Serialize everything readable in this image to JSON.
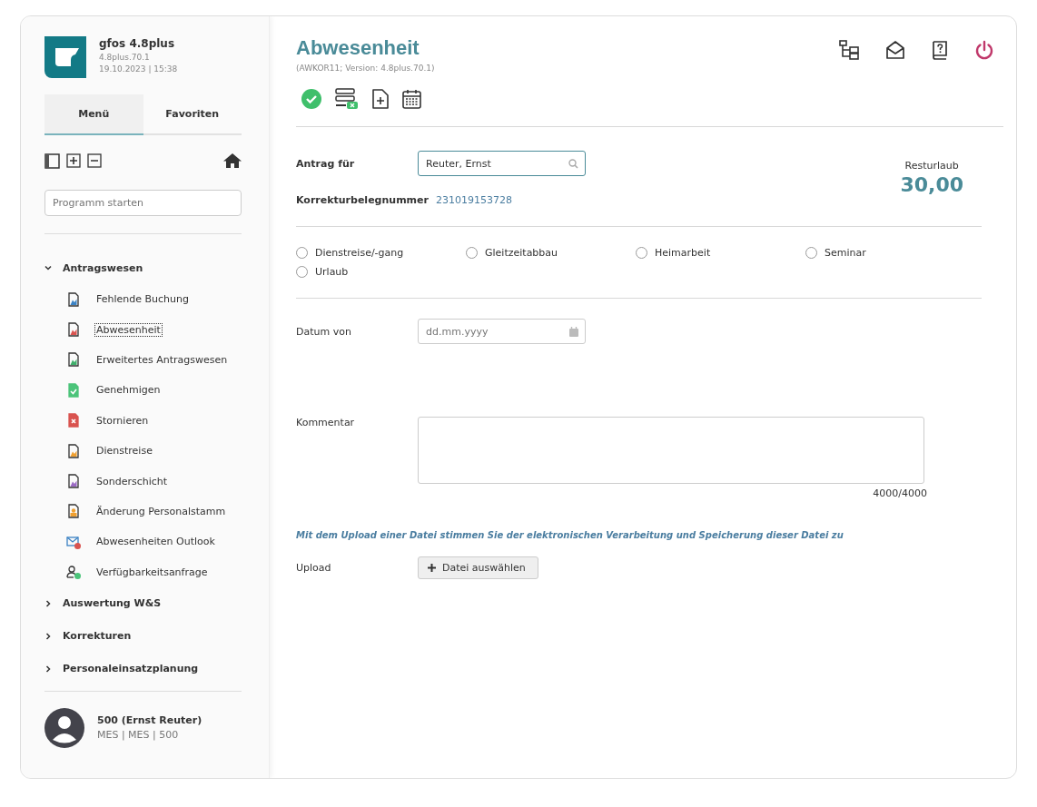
{
  "app": {
    "name": "gfos 4.8plus",
    "version": "4.8plus.70.1",
    "datetime": "19.10.2023 | 15:38"
  },
  "tabs": [
    {
      "label": "Menü",
      "selected": true
    },
    {
      "label": "Favoriten",
      "selected": false
    }
  ],
  "program_search": {
    "placeholder": "Programm starten"
  },
  "menu": [
    {
      "label": "Antragswesen",
      "expanded": true,
      "children": [
        {
          "label": "Fehlende Buchung",
          "kind": "doc",
          "color": "#3b82c4",
          "selected": false
        },
        {
          "label": "Abwesenheit",
          "kind": "doc",
          "color": "#d9534f",
          "selected": true
        },
        {
          "label": "Erweitertes Antragswesen",
          "kind": "doc",
          "color": "#3fae6a",
          "selected": false
        },
        {
          "label": "Genehmigen",
          "kind": "check",
          "color": "#4cc47a",
          "selected": false
        },
        {
          "label": "Stornieren",
          "kind": "cross",
          "color": "#d9534f",
          "selected": false
        },
        {
          "label": "Dienstreise",
          "kind": "doc",
          "color": "#f0a030",
          "selected": false
        },
        {
          "label": "Sonderschicht",
          "kind": "doc",
          "color": "#9b6ac4",
          "selected": false
        },
        {
          "label": "Änderung Personalstamm",
          "kind": "person-doc",
          "color": "#f0a030",
          "selected": false
        },
        {
          "label": "Abwesenheiten Outlook",
          "kind": "mail",
          "color": "#d9534f",
          "selected": false
        },
        {
          "label": "Verfügbarkeitsanfrage",
          "kind": "user",
          "color": "#4cc47a",
          "selected": false
        }
      ]
    },
    {
      "label": "Auswertung W&S",
      "expanded": false
    },
    {
      "label": "Korrekturen",
      "expanded": false
    },
    {
      "label": "Personaleinsatzplanung",
      "expanded": false
    }
  ],
  "user": {
    "name": "500 (Ernst Reuter)",
    "detail": "MES | MES | 500"
  },
  "page": {
    "title": "Abwesenheit",
    "subtitle": "(AWKOR11; Version: 4.8plus.70.1)"
  },
  "form": {
    "antrag_fuer": {
      "label": "Antrag für",
      "value": "Reuter, Ernst"
    },
    "beleg": {
      "label": "Korrekturbelegnummer",
      "value": "231019153728"
    },
    "resturlaub": {
      "label": "Resturlaub",
      "value": "30,00"
    },
    "types": [
      {
        "label": "Dienstreise/-gang",
        "selected": false
      },
      {
        "label": "Gleitzeitabbau",
        "selected": false
      },
      {
        "label": "Heimarbeit",
        "selected": false
      },
      {
        "label": "Seminar",
        "selected": false
      },
      {
        "label": "Urlaub",
        "selected": false
      }
    ],
    "datum_von": {
      "label": "Datum von",
      "placeholder": "dd.mm.yyyy"
    },
    "kommentar": {
      "label": "Kommentar",
      "counter": "4000/4000"
    },
    "upload_notice": "Mit dem Upload einer Datei stimmen Sie der elektronischen Verarbeitung und Speicherung dieser Datei zu",
    "upload": {
      "label": "Upload",
      "button": "Datei auswählen"
    }
  }
}
